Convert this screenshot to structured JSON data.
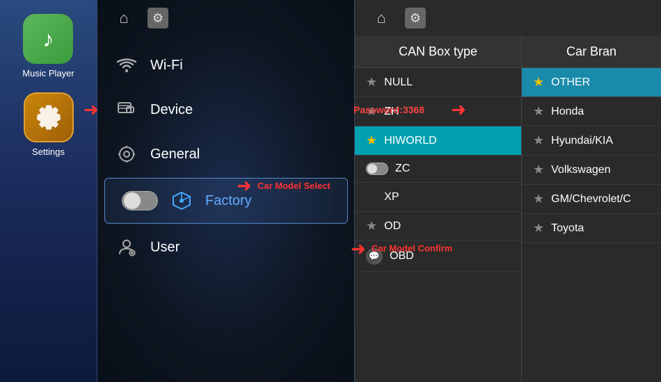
{
  "sidebar": {
    "apps": [
      {
        "id": "music-player",
        "label": "Music Player",
        "icon": "music"
      },
      {
        "id": "settings",
        "label": "Settings",
        "icon": "gear"
      }
    ]
  },
  "topbar": {
    "home_icon": "⌂",
    "settings_icon": "⚙"
  },
  "menu": {
    "items": [
      {
        "id": "wifi",
        "label": "Wi-Fi",
        "icon": "wifi"
      },
      {
        "id": "device",
        "label": "Device",
        "icon": "device"
      },
      {
        "id": "general",
        "label": "General",
        "icon": "general"
      },
      {
        "id": "factory",
        "label": "Factory",
        "icon": "factory",
        "active": true
      },
      {
        "id": "user",
        "label": "User",
        "icon": "user"
      }
    ],
    "password_hint": "Password:3368"
  },
  "right_panel": {
    "canbox_header": "CAN Box type",
    "carbrand_header": "Car Bran",
    "canbox_items": [
      {
        "id": "null",
        "label": "NULL",
        "star": false
      },
      {
        "id": "zh",
        "label": "ZH",
        "star": false
      },
      {
        "id": "hiworld",
        "label": "HIWORLD",
        "star": true,
        "selected": true
      },
      {
        "id": "zc",
        "label": "ZC",
        "star": false,
        "icon": "toggle"
      },
      {
        "id": "xp",
        "label": "XP",
        "star": false
      },
      {
        "id": "od",
        "label": "OD",
        "star": false
      },
      {
        "id": "obd",
        "label": "OBD",
        "icon": "speech"
      }
    ],
    "carbrand_items": [
      {
        "id": "other",
        "label": "OTHER",
        "star": true,
        "selected": true
      },
      {
        "id": "honda",
        "label": "Honda",
        "star": false
      },
      {
        "id": "hyundai",
        "label": "Hyundai/KIA",
        "star": false
      },
      {
        "id": "volkswagen",
        "label": "Volkswagen",
        "star": false
      },
      {
        "id": "gm",
        "label": "GM/Chevrolet/C",
        "star": false
      },
      {
        "id": "toyota",
        "label": "Toyota",
        "star": false
      }
    ]
  },
  "annotations": {
    "car_model_select": "Car Model Select",
    "car_model_confirm": "Car Model Confirm"
  }
}
